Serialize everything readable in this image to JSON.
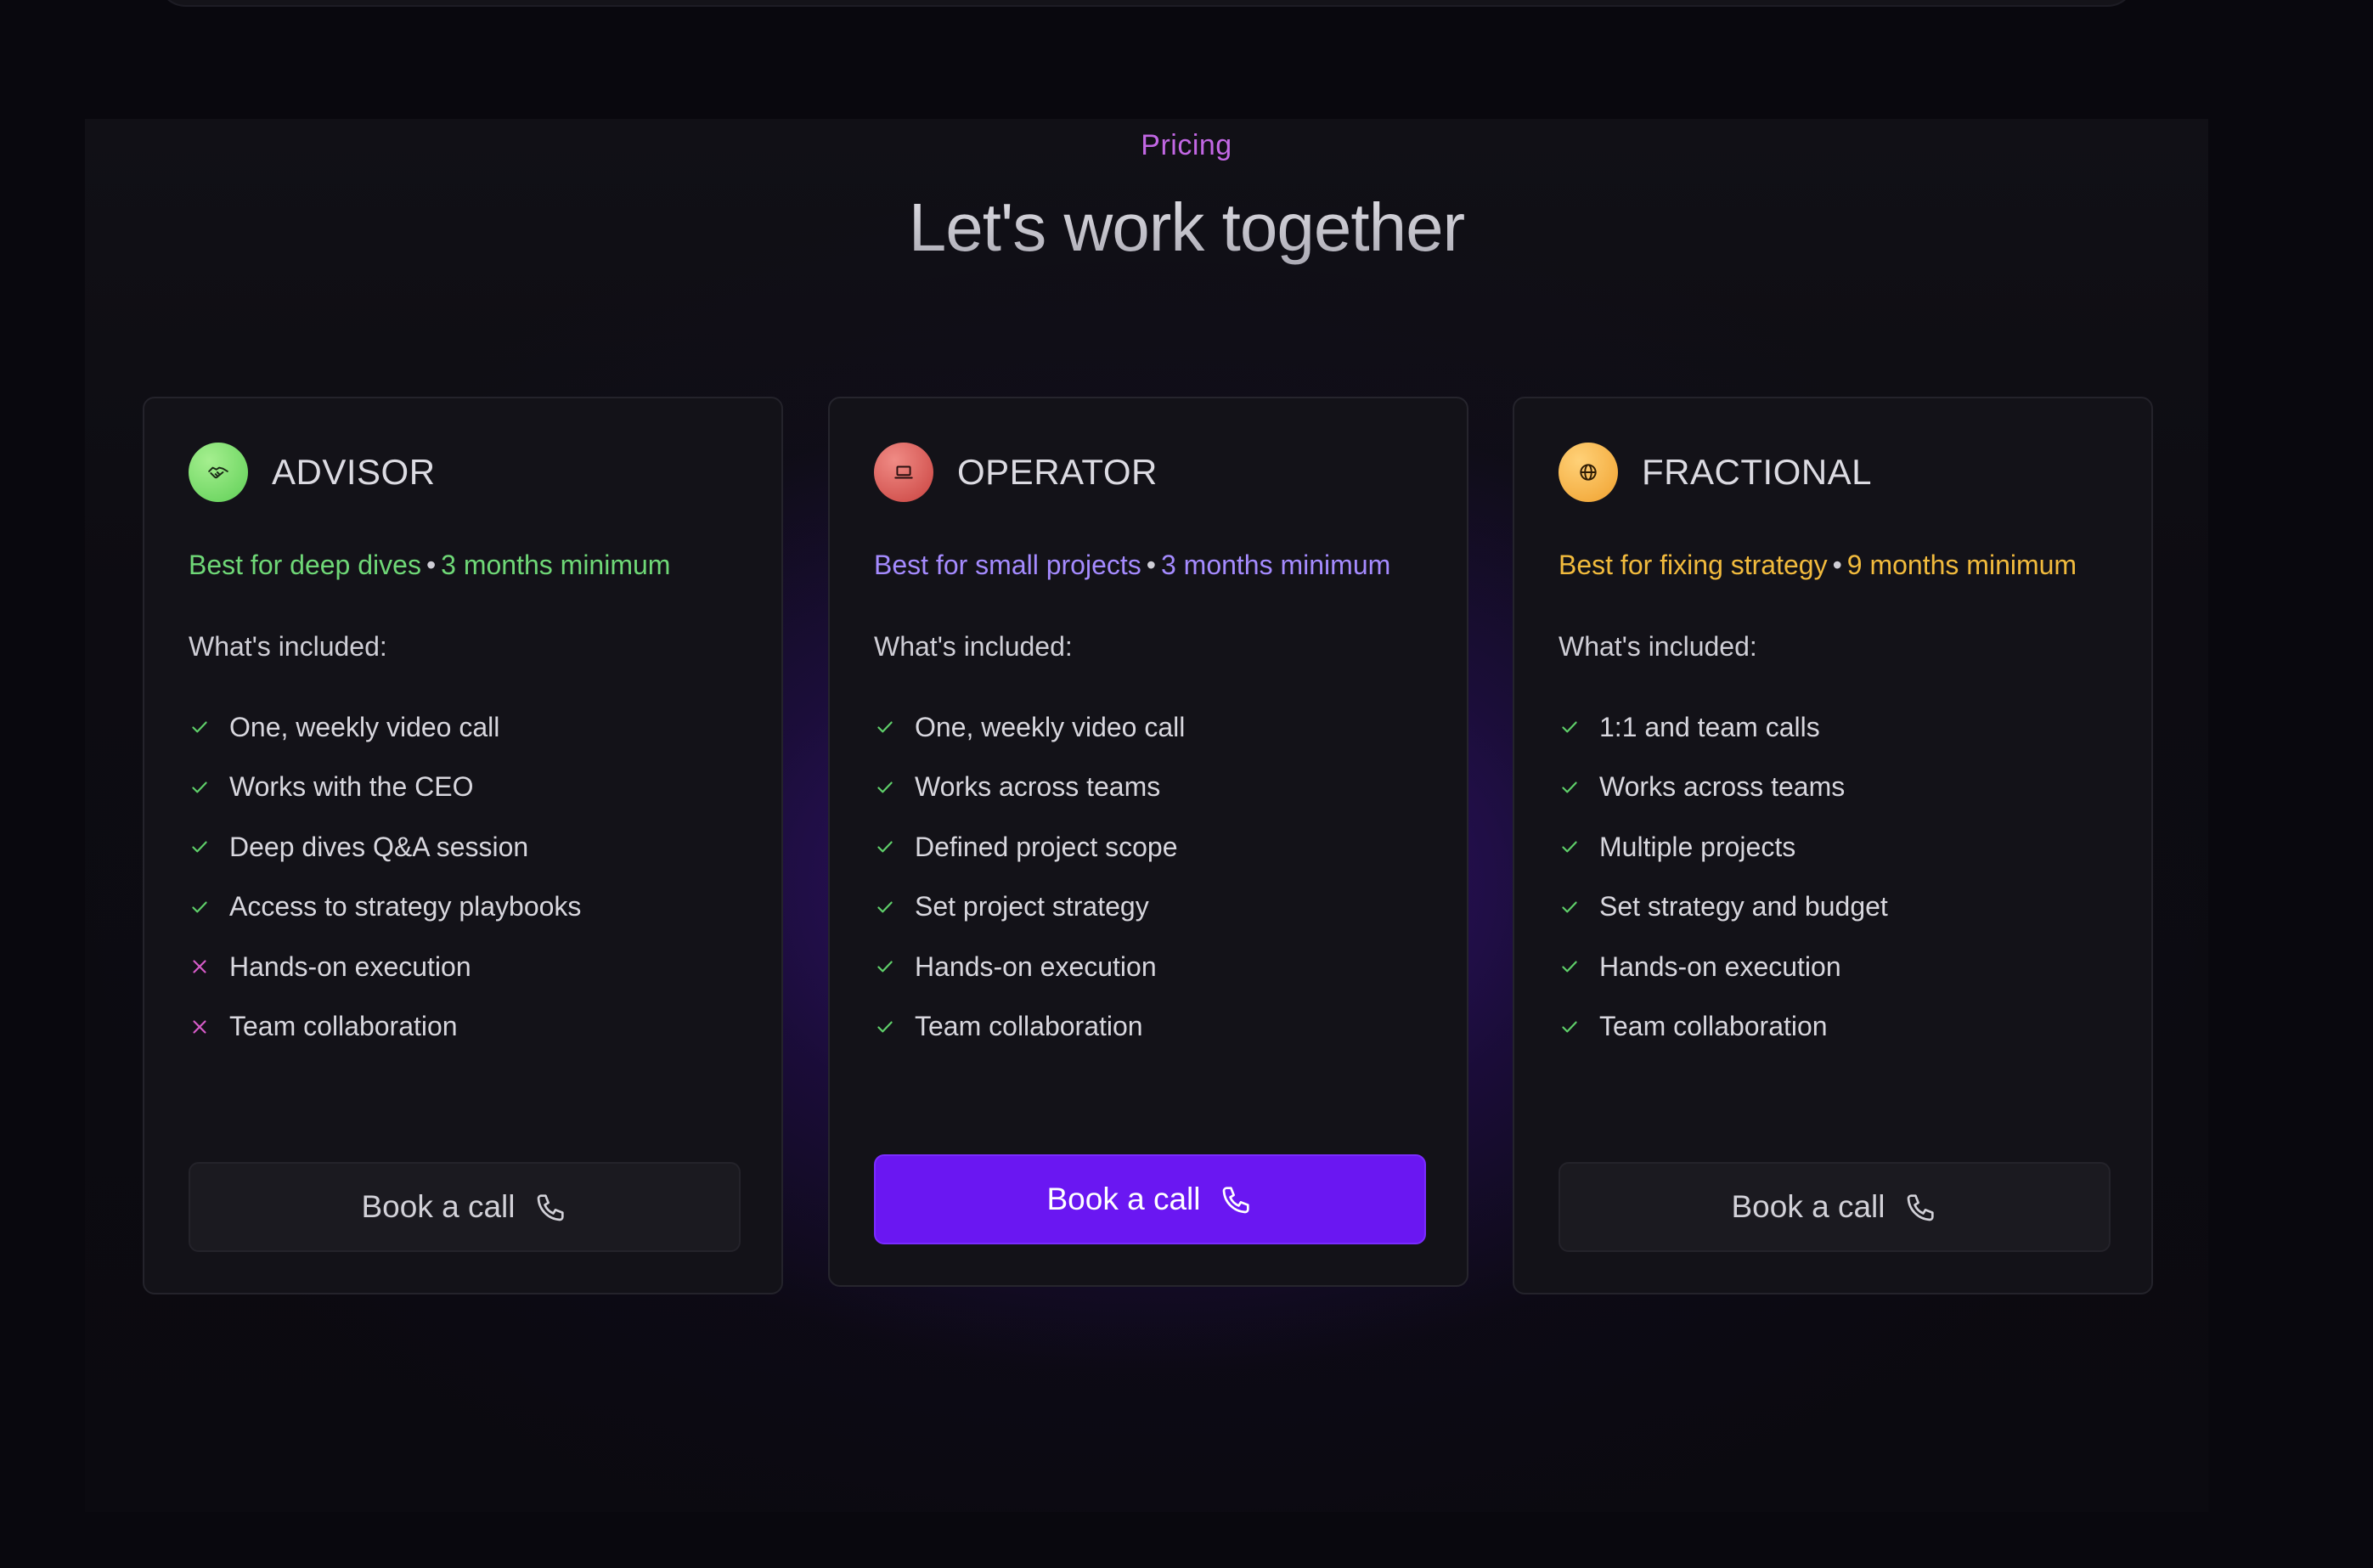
{
  "section": {
    "eyebrow": "Pricing",
    "title": "Let's work together"
  },
  "plans": [
    {
      "name": "ADVISOR",
      "icon": "handshake-icon",
      "icon_color": "#6fd66a",
      "accent": "#6fd877",
      "best_for": "Best for deep dives",
      "minimum": "3 months minimum",
      "included_label": "What's included:",
      "features": [
        {
          "label": "One, weekly video call",
          "included": true
        },
        {
          "label": "Works with the CEO",
          "included": true
        },
        {
          "label": "Deep dives Q&A session",
          "included": true
        },
        {
          "label": "Access to strategy playbooks",
          "included": true
        },
        {
          "label": "Hands-on execution",
          "included": false
        },
        {
          "label": "Team collaboration",
          "included": false
        }
      ],
      "cta": "Book a call"
    },
    {
      "name": "OPERATOR",
      "icon": "laptop-icon",
      "icon_color": "#d9524d",
      "accent": "#a58bff",
      "best_for": "Best for small projects",
      "minimum": "3 months minimum",
      "included_label": "What's included:",
      "features": [
        {
          "label": "One, weekly video call",
          "included": true
        },
        {
          "label": "Works across teams",
          "included": true
        },
        {
          "label": "Defined project scope",
          "included": true
        },
        {
          "label": "Set project strategy",
          "included": true
        },
        {
          "label": "Hands-on execution",
          "included": true
        },
        {
          "label": "Team collaboration",
          "included": true
        }
      ],
      "cta": "Book a call"
    },
    {
      "name": "FRACTIONAL",
      "icon": "globe-icon",
      "icon_color": "#f4ad3a",
      "accent": "#f2bb3d",
      "best_for": "Best for fixing strategy",
      "minimum": "9 months minimum",
      "included_label": "What's included:",
      "features": [
        {
          "label": "1:1 and team calls",
          "included": true
        },
        {
          "label": "Works across teams",
          "included": true
        },
        {
          "label": "Multiple projects",
          "included": true
        },
        {
          "label": "Set strategy and budget",
          "included": true
        },
        {
          "label": "Hands-on execution",
          "included": true
        },
        {
          "label": "Team collaboration",
          "included": true
        }
      ],
      "cta": "Book a call"
    }
  ],
  "colors": {
    "check": "#5fcf6a",
    "cross": "#d65bc8",
    "primary_button": "#6a17f2"
  }
}
